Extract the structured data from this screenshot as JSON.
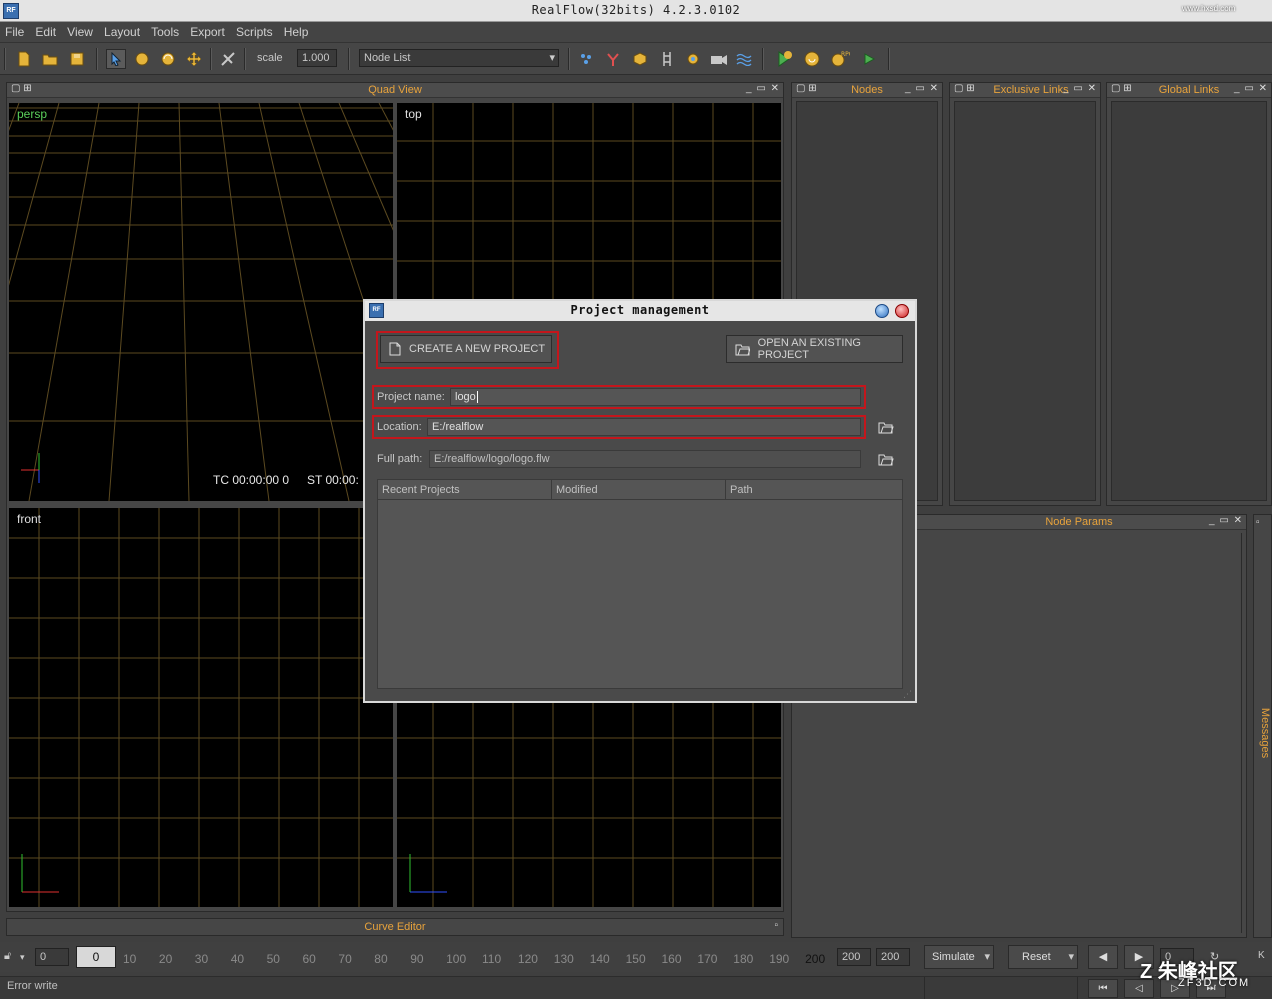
{
  "window": {
    "title": "RealFlow(32bits) 4.2.3.0102",
    "app_icon_text": "RF"
  },
  "menu": [
    "File",
    "Edit",
    "View",
    "Layout",
    "Tools",
    "Export",
    "Scripts",
    "Help"
  ],
  "toolbar": {
    "scale_label": "scale",
    "scale_value": "1.000",
    "node_list_value": "Node List"
  },
  "panels": {
    "quad_view": "Quad View",
    "nodes": "Nodes",
    "exclusive_links": "Exclusive Links",
    "global_links": "Global Links",
    "node_params": "Node Params",
    "curve_editor": "Curve Editor",
    "messages": "Messages"
  },
  "viewports": {
    "persp": "persp",
    "top": "top",
    "front": "front",
    "tc": "TC 00:00:00 0",
    "st": "ST 00:00:"
  },
  "dialog": {
    "title": "Project management",
    "create_label": "CREATE A NEW PROJECT",
    "open_label": "OPEN AN EXISTING PROJECT",
    "project_name_label": "Project name:",
    "project_name_value": "logo",
    "location_label": "Location:",
    "location_value": "E:/realflow",
    "full_path_label": "Full path:",
    "full_path_value": "E:/realflow/logo/logo.flw",
    "columns": [
      "Recent Projects",
      "Modified",
      "Path"
    ]
  },
  "timeline": {
    "start_value": "0",
    "current_frame": "0",
    "ticks": [
      "10",
      "20",
      "30",
      "40",
      "50",
      "60",
      "70",
      "80",
      "90",
      "100",
      "110",
      "120",
      "130",
      "140",
      "150",
      "160",
      "170",
      "180",
      "190",
      "200"
    ],
    "end_value": "200",
    "end_value2": "200",
    "simulate_label": "Simulate",
    "reset_label": "Reset",
    "frame_value": "0"
  },
  "status": {
    "text": "Error write"
  },
  "watermarks": {
    "top_right": "www.hxsd.com",
    "bottom_right": "朱峰社区",
    "bottom_right_url": "ZF3D.COM"
  }
}
